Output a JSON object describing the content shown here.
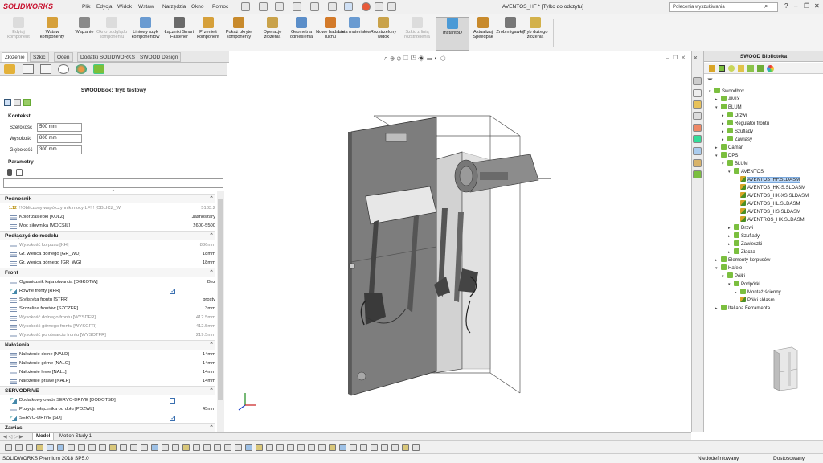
{
  "app": {
    "logo": "SOLIDWORKS",
    "menus": [
      "Plik",
      "Edycja",
      "Widok",
      "Wstaw",
      "Narzędzia",
      "Okno",
      "Pomoc"
    ],
    "doc_title": "AVENTOS_HF * [Tylko do odczytu]",
    "search_placeholder": "Polecenia wyszukiwania",
    "win_controls": [
      "?",
      "–",
      "❐",
      "✕"
    ]
  },
  "commands": [
    {
      "label": "Edytuj komponent",
      "state": "disabled",
      "color": "#b8b8b8"
    },
    {
      "label": "Wstaw komponenty",
      "state": "normal",
      "color": "#d6a03a"
    },
    {
      "label": "Wiązanie",
      "state": "normal",
      "color": "#8a8a8a"
    },
    {
      "label": "Okno podglądu komponentu",
      "state": "disabled",
      "color": "#b8b8b8"
    },
    {
      "label": "Liniowy szyk komponentów",
      "state": "normal",
      "color": "#6a9bd1"
    },
    {
      "label": "Łączniki Smart Fastener",
      "state": "normal",
      "color": "#6a6a6a"
    },
    {
      "label": "Przenieś komponent",
      "state": "normal",
      "color": "#d6a03a"
    },
    {
      "label": "Pokaż ukryte komponenty",
      "state": "normal",
      "color": "#c88a2c"
    },
    {
      "label": "Operacje złożenia",
      "state": "normal",
      "color": "#c9a24a"
    },
    {
      "label": "Geometria odniesienia",
      "state": "normal",
      "color": "#5b8ec9"
    },
    {
      "label": "Nowe badanie ruchu",
      "state": "normal",
      "color": "#d37a2a"
    },
    {
      "label": "Lista materiałów",
      "state": "normal",
      "color": "#6a9bd1"
    },
    {
      "label": "Rozstrzelony widok",
      "state": "normal",
      "color": "#c9a24a"
    },
    {
      "label": "Szkic z linią rozstrzelenia",
      "state": "disabled",
      "color": "#b8b8b8"
    },
    {
      "label": "Instant3D",
      "state": "active",
      "color": "#4b9ad6"
    },
    {
      "label": "Aktualizuj Speedpak",
      "state": "normal",
      "color": "#c88a2c"
    },
    {
      "label": "Zrób migawkę",
      "state": "normal",
      "color": "#777777"
    },
    {
      "label": "Tryb dużego złożenia",
      "state": "normal",
      "color": "#d3b14a"
    }
  ],
  "cm_tabs": [
    "Złożenie",
    "Szkic",
    "Oceń",
    "Dodatki SOLIDWORKS",
    "SWOOD Design"
  ],
  "cm_tab_selected": 0,
  "panel": {
    "title": "SWOODBox: Tryb testowy",
    "kontekst": {
      "heading": "Kontekst",
      "fields": [
        {
          "label": "Szerokość",
          "value": "500 mm"
        },
        {
          "label": "Wysokość",
          "value": "800 mm"
        },
        {
          "label": "Głębokość",
          "value": "300 mm"
        }
      ]
    },
    "parametry": {
      "heading": "Parametry"
    },
    "groups": [
      {
        "heading": "Podnośnik",
        "rows": [
          {
            "code": "1.12",
            "name": "!!Obliczony współczynnik mocy LF!!! [OBLICZ_W",
            "value": "5183.2",
            "grey": true
          },
          {
            "name": "Kolor zaślepki [KOLZ]",
            "value": "Jasnoszary",
            "grey": false
          },
          {
            "name": "Moc siłownika [MOCSIL]",
            "value": "2600-5500",
            "grey": false
          }
        ]
      },
      {
        "heading": "Podłączyć do modelu",
        "rows": [
          {
            "name": "Wysokość korpusu [KH]",
            "value": "836mm",
            "grey": true
          },
          {
            "name": "Gr. wieńca dolnego [GR_WD]",
            "value": "18mm",
            "grey": false
          },
          {
            "name": "Gr. wieńca górnego [GR_WG]",
            "value": "18mm",
            "grey": false
          }
        ]
      },
      {
        "heading": "Front",
        "rows": [
          {
            "name": "Ogranicznik kąta otwarcia [OGKOTW]",
            "value": "Bez",
            "grey": false
          },
          {
            "name": "Równe fronty [RFR]",
            "value": "",
            "checkbox": true,
            "checked": true,
            "grey": false
          },
          {
            "name": "Stylistyka frontu  [STFR]",
            "value": "prosty",
            "grey": false
          },
          {
            "name": "Szczelina frontów [SZCZFR]",
            "value": "3mm",
            "grey": false
          },
          {
            "name": "Wysokość dolnego frontu [WYSDFR]",
            "value": "412.5mm",
            "grey": true
          },
          {
            "name": "Wysokość górnego frontu [WYSGFR]",
            "value": "412.5mm",
            "grey": true
          },
          {
            "name": "Wysokość po otwarciu frontu [WYSOTFR]",
            "value": "219.5mm",
            "grey": true
          }
        ]
      },
      {
        "heading": "Nałożenia",
        "rows": [
          {
            "name": "Nałożenie dolne [NALD]",
            "value": "14mm",
            "grey": false
          },
          {
            "name": "Nałożenie górne [NALG]",
            "value": "14mm",
            "grey": false
          },
          {
            "name": "Nałożenie lewe [NALL]",
            "value": "14mm",
            "grey": false
          },
          {
            "name": "Nałożenie prawe [NALP]",
            "value": "14mm",
            "grey": false
          }
        ]
      },
      {
        "heading": "SERVODRIVE",
        "rows": [
          {
            "name": "Dodatkowy otwór SERVO-DRIVE [DODOTSD]",
            "value": "",
            "checkbox": true,
            "checked": false,
            "grey": false
          },
          {
            "name": "Pozycja włącznika od dołu [POZWL]",
            "value": "45mm",
            "grey": false
          },
          {
            "name": "SERVO-DRIVE [SD]",
            "value": "",
            "checkbox": true,
            "checked": true,
            "grey": false
          }
        ]
      },
      {
        "heading": "Zawias",
        "rows": []
      }
    ]
  },
  "model_tabs": [
    "Model",
    "Motion Study 1"
  ],
  "status": {
    "left": "SOLIDWORKS Premium 2018 SP5.0",
    "mid": "Niedodefiniowany",
    "right": "Dostosowany"
  },
  "library": {
    "title": "SWOOD Biblioteka",
    "tree": [
      {
        "label": "Swoodbox",
        "level": 0,
        "open": true,
        "type": "folder"
      },
      {
        "label": "AMIX",
        "level": 1,
        "open": false,
        "type": "folder"
      },
      {
        "label": "BLUM",
        "level": 1,
        "open": true,
        "type": "folder"
      },
      {
        "label": "Drzwi",
        "level": 2,
        "open": false,
        "type": "folder"
      },
      {
        "label": "Regulator frontu",
        "level": 2,
        "open": false,
        "type": "folder"
      },
      {
        "label": "Szuflady",
        "level": 2,
        "open": false,
        "type": "folder"
      },
      {
        "label": "Zawiasy",
        "level": 2,
        "open": false,
        "type": "folder"
      },
      {
        "label": "Camar",
        "level": 1,
        "open": false,
        "type": "folder"
      },
      {
        "label": "DPS",
        "level": 1,
        "open": true,
        "type": "folder"
      },
      {
        "label": "BLUM",
        "level": 2,
        "open": true,
        "type": "folder"
      },
      {
        "label": "AVENTOS",
        "level": 3,
        "open": true,
        "type": "folder"
      },
      {
        "label": "AVENTOS_HF.SLDASM",
        "level": 4,
        "type": "asm",
        "selected": true
      },
      {
        "label": "AVENTOS_HK-S.SLDASM",
        "level": 4,
        "type": "asm"
      },
      {
        "label": "AVENTOS_HK-XS.SLDASM",
        "level": 4,
        "type": "asm"
      },
      {
        "label": "AVENTOS_HL.SLDASM",
        "level": 4,
        "type": "asm"
      },
      {
        "label": "AVENTOS_HS.SLDASM",
        "level": 4,
        "type": "asm"
      },
      {
        "label": "AVENTROS_HK.SLDASM",
        "level": 4,
        "type": "asm"
      },
      {
        "label": "Drzwi",
        "level": 3,
        "open": false,
        "type": "folder"
      },
      {
        "label": "Szuflady",
        "level": 3,
        "open": false,
        "type": "folder"
      },
      {
        "label": "Zawieszki",
        "level": 3,
        "open": false,
        "type": "folder"
      },
      {
        "label": "Złącza",
        "level": 3,
        "open": false,
        "type": "folder"
      },
      {
        "label": "Elementy korpusów",
        "level": 1,
        "open": false,
        "type": "folder"
      },
      {
        "label": "Hafele",
        "level": 1,
        "open": true,
        "type": "folder"
      },
      {
        "label": "Półki",
        "level": 2,
        "open": true,
        "type": "folder"
      },
      {
        "label": "Podpórki",
        "level": 3,
        "open": true,
        "type": "folder"
      },
      {
        "label": "Montaż ścienny",
        "level": 4,
        "open": false,
        "type": "folder"
      },
      {
        "label": "Półki.sldasm",
        "level": 4,
        "type": "asm"
      },
      {
        "label": "Italiana Ferramenta",
        "level": 1,
        "open": false,
        "type": "folder"
      }
    ]
  },
  "colors": {
    "accent": "#c8102e",
    "panel_door": "#7d7d7d",
    "selection": "#bcd7f5",
    "folder": "#7bbf3f"
  }
}
